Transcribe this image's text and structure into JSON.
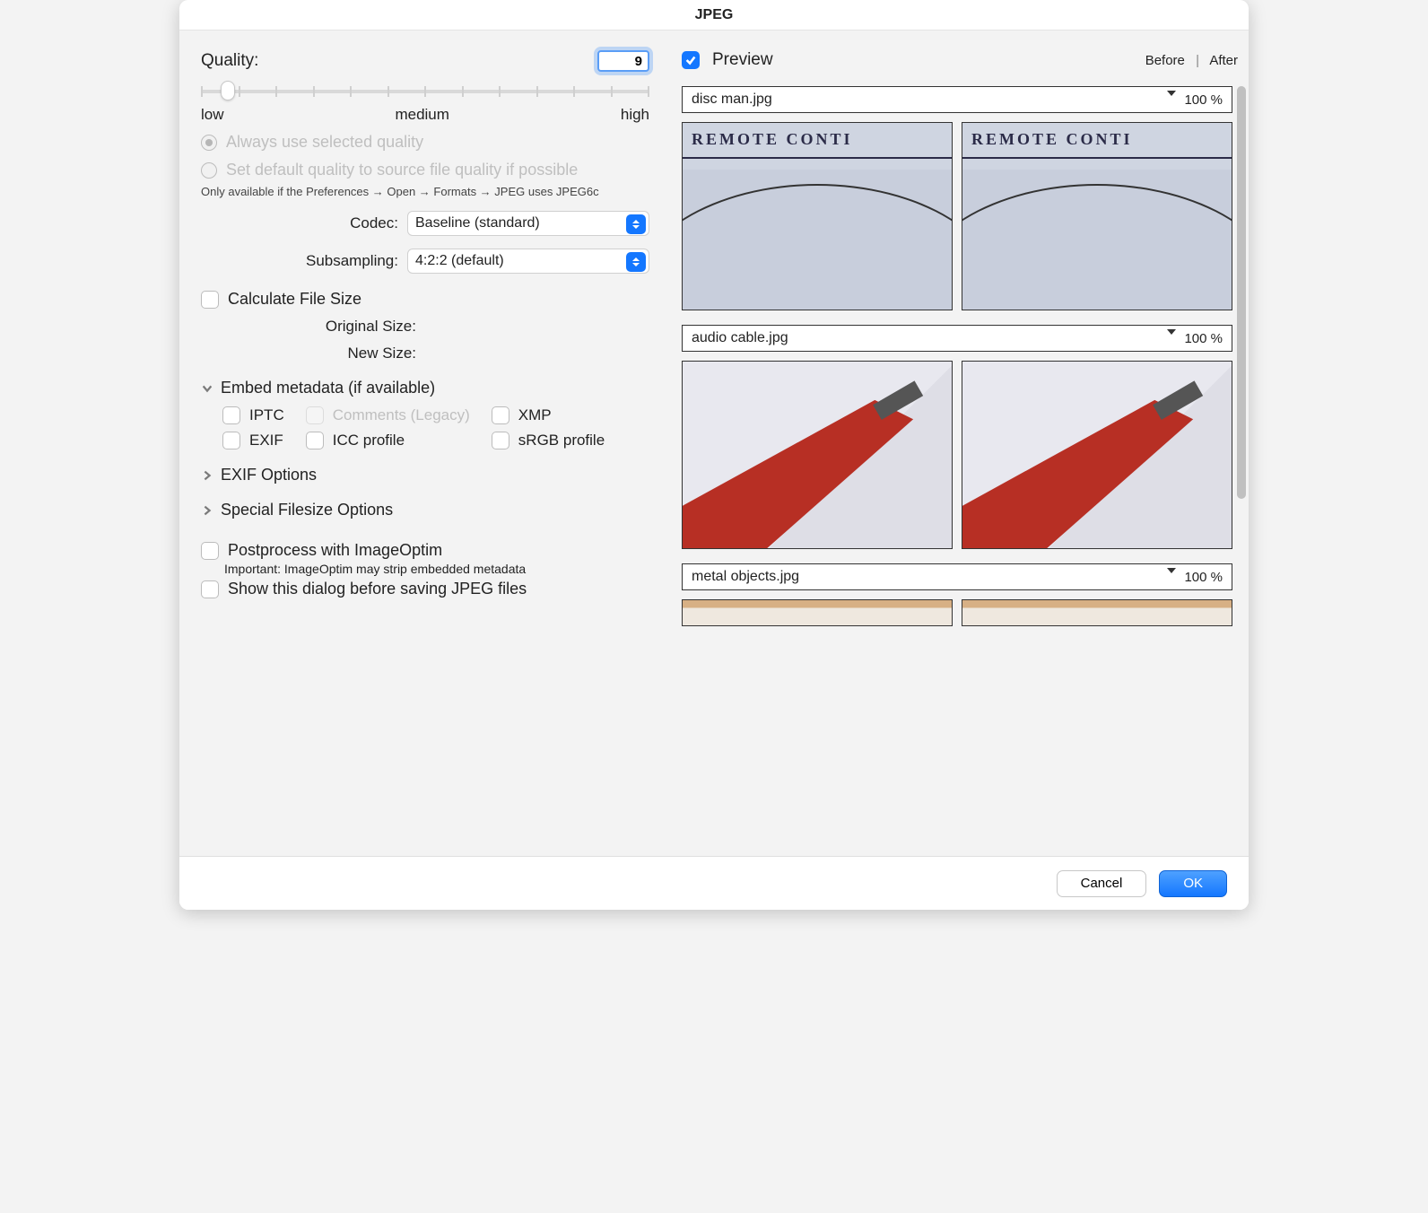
{
  "window_title": "JPEG",
  "quality": {
    "label": "Quality:",
    "value": "9",
    "low": "low",
    "medium": "medium",
    "high": "high"
  },
  "quality_options": {
    "always": "Always use selected quality",
    "source": "Set default quality to source file quality if possible",
    "help": "Only available if the Preferences → Open → Formats → JPEG uses JPEG6c"
  },
  "codec": {
    "label": "Codec:",
    "value": "Baseline (standard)"
  },
  "subsampling": {
    "label": "Subsampling:",
    "value": "4:2:2 (default)"
  },
  "calc_size_label": "Calculate File Size",
  "original_size_label": "Original Size:",
  "new_size_label": "New Size:",
  "embed_meta_title": "Embed metadata (if available)",
  "meta": {
    "iptc": "IPTC",
    "exif": "EXIF",
    "comments": "Comments (Legacy)",
    "icc": "ICC profile",
    "xmp": "XMP",
    "srgb": "sRGB profile"
  },
  "exif_options_title": "EXIF Options",
  "special_options_title": "Special Filesize Options",
  "postprocess_label": "Postprocess with ImageOptim",
  "postprocess_note": "Important: ImageOptim may strip embedded metadata",
  "show_dialog_label": "Show this dialog before saving JPEG files",
  "preview": {
    "checkbox_label": "Preview",
    "before": "Before",
    "after": "After"
  },
  "files": [
    {
      "name": "disc man.jpg",
      "zoom": "100 %",
      "kind": "disc"
    },
    {
      "name": "audio cable.jpg",
      "zoom": "100 %",
      "kind": "cable"
    },
    {
      "name": "metal objects.jpg",
      "zoom": "100 %",
      "kind": "metal"
    }
  ],
  "buttons": {
    "cancel": "Cancel",
    "ok": "OK"
  }
}
